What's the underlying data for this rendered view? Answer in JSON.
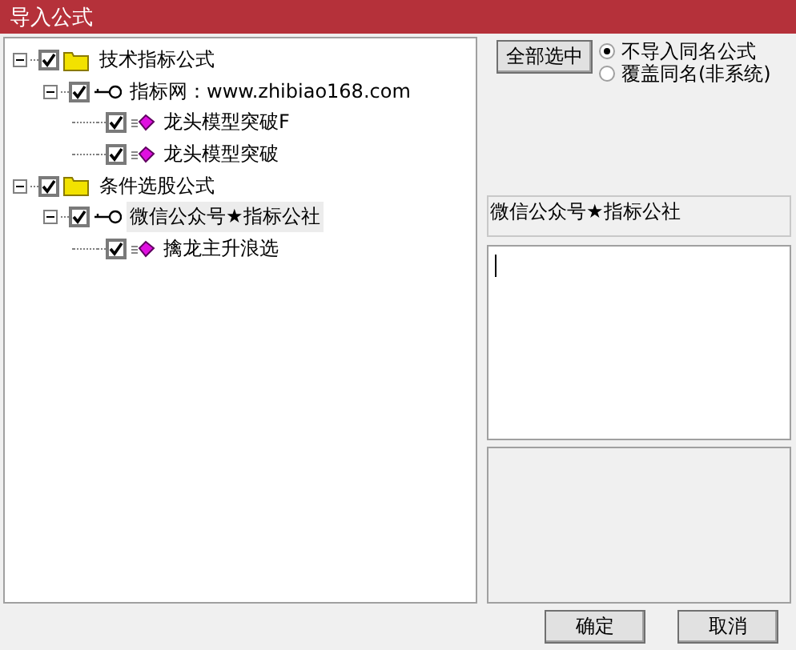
{
  "window": {
    "title": "导入公式"
  },
  "tree": [
    {
      "label": "技术指标公式",
      "kind": "folder",
      "checked": true,
      "expanded": true,
      "selected": false,
      "children": [
        {
          "label": "指标网：www.zhibiao168.com",
          "kind": "key",
          "checked": true,
          "expanded": true,
          "selected": false,
          "children": [
            {
              "label": "龙头模型突破F",
              "kind": "formula",
              "checked": true,
              "selected": false
            },
            {
              "label": "龙头模型突破",
              "kind": "formula",
              "checked": true,
              "selected": false
            }
          ]
        }
      ]
    },
    {
      "label": "条件选股公式",
      "kind": "folder",
      "checked": true,
      "expanded": true,
      "selected": false,
      "children": [
        {
          "label": "微信公众号★指标公社",
          "kind": "key",
          "checked": true,
          "expanded": true,
          "selected": true,
          "children": [
            {
              "label": "擒龙主升浪选",
              "kind": "formula",
              "checked": true,
              "selected": false
            }
          ]
        }
      ]
    }
  ],
  "select_all_button": "全部选中",
  "options": [
    {
      "label": "不导入同名公式",
      "selected": true
    },
    {
      "label": "覆盖同名(非系统)",
      "selected": false
    }
  ],
  "name_label": "微信公众号★指标公社",
  "buttons": [
    "确定",
    "取消"
  ]
}
